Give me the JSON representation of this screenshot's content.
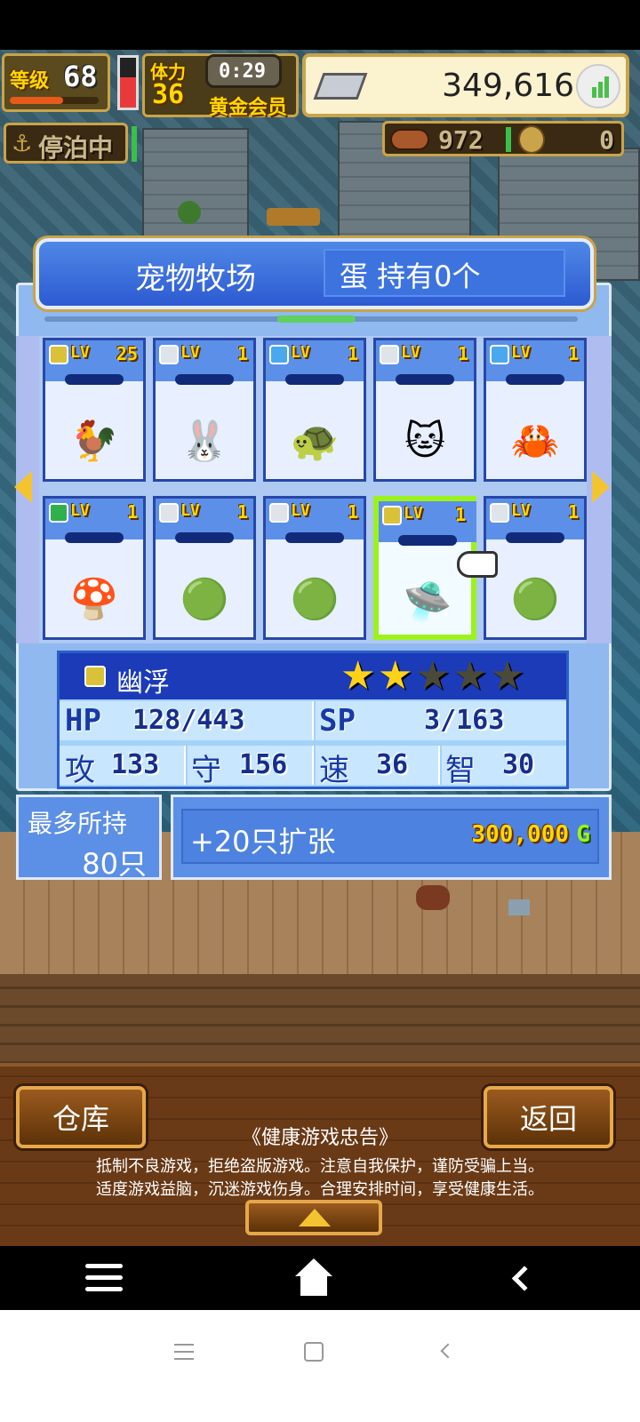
{
  "hud": {
    "level_label": "等级",
    "level": "68",
    "stamina_label": "体力",
    "stamina": "36",
    "timer": "0:29",
    "membership": "黄金会员",
    "gold": "349,616",
    "anchor_status": "停泊中",
    "resource_count": "972",
    "medals": "0"
  },
  "panel": {
    "title": "宠物牧场",
    "egg_status": "蛋 持有0个"
  },
  "pets": [
    {
      "rarity": "gold",
      "lv_label": "LV",
      "level": "25",
      "sprite": "rooster"
    },
    {
      "rarity": "white",
      "lv_label": "LV",
      "level": "1",
      "sprite": "pink-bunny"
    },
    {
      "rarity": "blue",
      "lv_label": "LV",
      "level": "1",
      "sprite": "turtle"
    },
    {
      "rarity": "white",
      "lv_label": "LV",
      "level": "1",
      "sprite": "white-cat"
    },
    {
      "rarity": "blue",
      "lv_label": "LV",
      "level": "1",
      "sprite": "hermit-crab"
    },
    {
      "rarity": "green",
      "lv_label": "LV",
      "level": "1",
      "sprite": "mushroom-man"
    },
    {
      "rarity": "white",
      "lv_label": "LV",
      "level": "1",
      "sprite": "green-slime"
    },
    {
      "rarity": "white",
      "lv_label": "LV",
      "level": "1",
      "sprite": "green-slime"
    },
    {
      "rarity": "gold",
      "lv_label": "LV",
      "level": "1",
      "sprite": "ufo",
      "selected": true
    },
    {
      "rarity": "white",
      "lv_label": "LV",
      "level": "1",
      "sprite": "green-slime"
    }
  ],
  "selected_pet": {
    "name": "幽浮",
    "stars_filled": 2,
    "stars_total": 5,
    "hp_label": "HP",
    "hp": "128/443",
    "sp_label": "SP",
    "sp": "3/163",
    "atk_label": "攻",
    "atk": "133",
    "def_label": "守",
    "def": "156",
    "spd_label": "速",
    "spd": "36",
    "int_label": "智",
    "int": "30"
  },
  "capacity": {
    "label": "最多所持",
    "value": "80只"
  },
  "expand": {
    "label": "+20只扩张",
    "cost": "300,000",
    "currency": "G"
  },
  "bottom": {
    "warehouse": "仓库",
    "back": "返回",
    "notice_title": "《健康游戏忠告》",
    "notice_line1": "抵制不良游戏，拒绝盗版游戏。注意自我保护，谨防受骗上当。",
    "notice_line2": "适度游戏益脑，沉迷游戏伤身。合理安排时间，享受健康生活。"
  },
  "colors": {
    "rarity_gold": "#d9c23a",
    "rarity_white": "#dfe3ea",
    "rarity_blue": "#4aa8ef",
    "rarity_green": "#2fb04a",
    "selected_border": "#9cf21c",
    "star_filled": "#ffd21a",
    "star_empty": "#4a4a3a"
  }
}
